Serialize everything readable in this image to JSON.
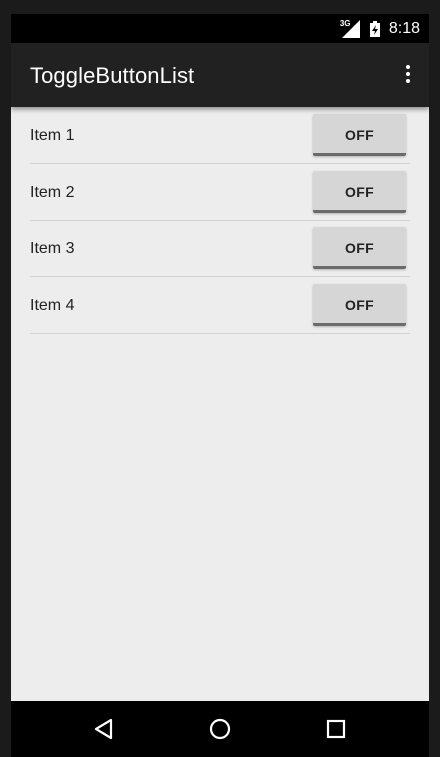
{
  "status_bar": {
    "network": "3G",
    "time": "8:18"
  },
  "app_bar": {
    "title": "ToggleButtonList",
    "overflow_icon": "overflow-menu-icon"
  },
  "list": {
    "items": [
      {
        "label": "Item 1",
        "toggle": "OFF"
      },
      {
        "label": "Item 2",
        "toggle": "OFF"
      },
      {
        "label": "Item 3",
        "toggle": "OFF"
      },
      {
        "label": "Item 4",
        "toggle": "OFF"
      }
    ]
  },
  "nav_bar": {
    "icons": [
      "back-icon",
      "home-icon",
      "recents-icon"
    ]
  }
}
